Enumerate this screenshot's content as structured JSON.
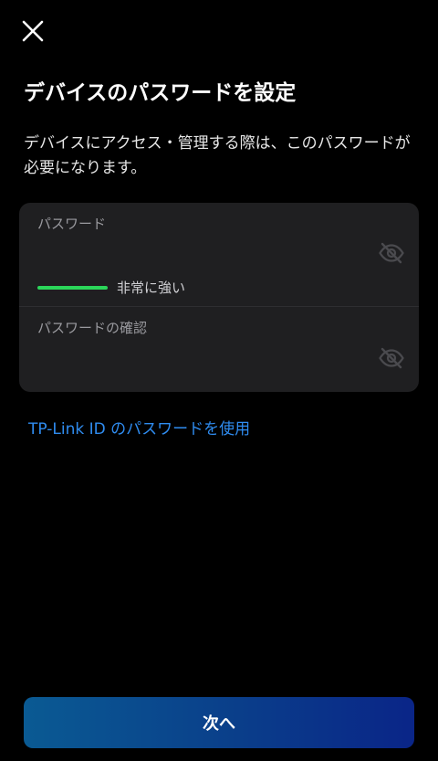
{
  "header": {
    "close_icon": "close-icon"
  },
  "page": {
    "title": "デバイスのパスワードを設定",
    "description": "デバイスにアクセス・管理する際は、このパスワードが必要になります。"
  },
  "form": {
    "password": {
      "label": "パスワード",
      "value": "",
      "visibility_icon": "eye-off-icon",
      "strength": {
        "label": "非常に強い",
        "color": "#2bd65a"
      }
    },
    "confirm": {
      "label": "パスワードの確認",
      "value": "",
      "visibility_icon": "eye-off-icon"
    }
  },
  "links": {
    "use_tplink_id": "TP-Link ID のパスワードを使用"
  },
  "footer": {
    "next_label": "次へ"
  },
  "colors": {
    "background": "#000000",
    "card": "#1f1f21",
    "link": "#2f8cf0",
    "button_start": "#0a5a93",
    "button_end": "#0a2588"
  }
}
